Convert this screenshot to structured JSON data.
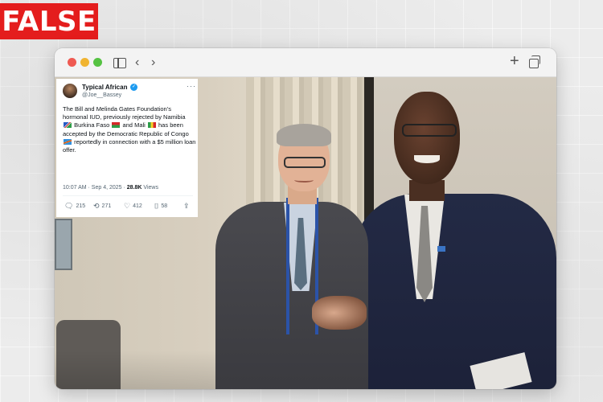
{
  "badge": {
    "label": "FALSE"
  },
  "browser": {
    "sidebar_icon": "sidebar-icon",
    "back_icon": "chevron-left-icon",
    "forward_icon": "chevron-right-icon",
    "new_tab_icon": "plus-icon",
    "tabs_icon": "tabs-overview-icon"
  },
  "tweet": {
    "display_name": "Typical African",
    "handle": "@Joe__Bassey",
    "verified": true,
    "text": {
      "p1": "The Bill and Melinda Gates Foundation’s hormonal IUD, previously rejected by Namibia",
      "p2": "Burkina Faso",
      "p3": "and Mali",
      "p4": "has been accepted by the Democratic Republic of Congo",
      "p5": "reportedly in connection with a $5 million loan offer."
    },
    "time": "10:07 AM · Sep 4, 2025 ·",
    "views_count": "28.8K",
    "views_label": "Views",
    "actions": {
      "replies": "215",
      "reposts": "271",
      "likes": "412",
      "bookmarks": "58"
    }
  },
  "colors": {
    "badge_red": "#e41d1d",
    "verified_blue": "#1d9bf0",
    "lanyard_blue": "#2b53a8"
  }
}
